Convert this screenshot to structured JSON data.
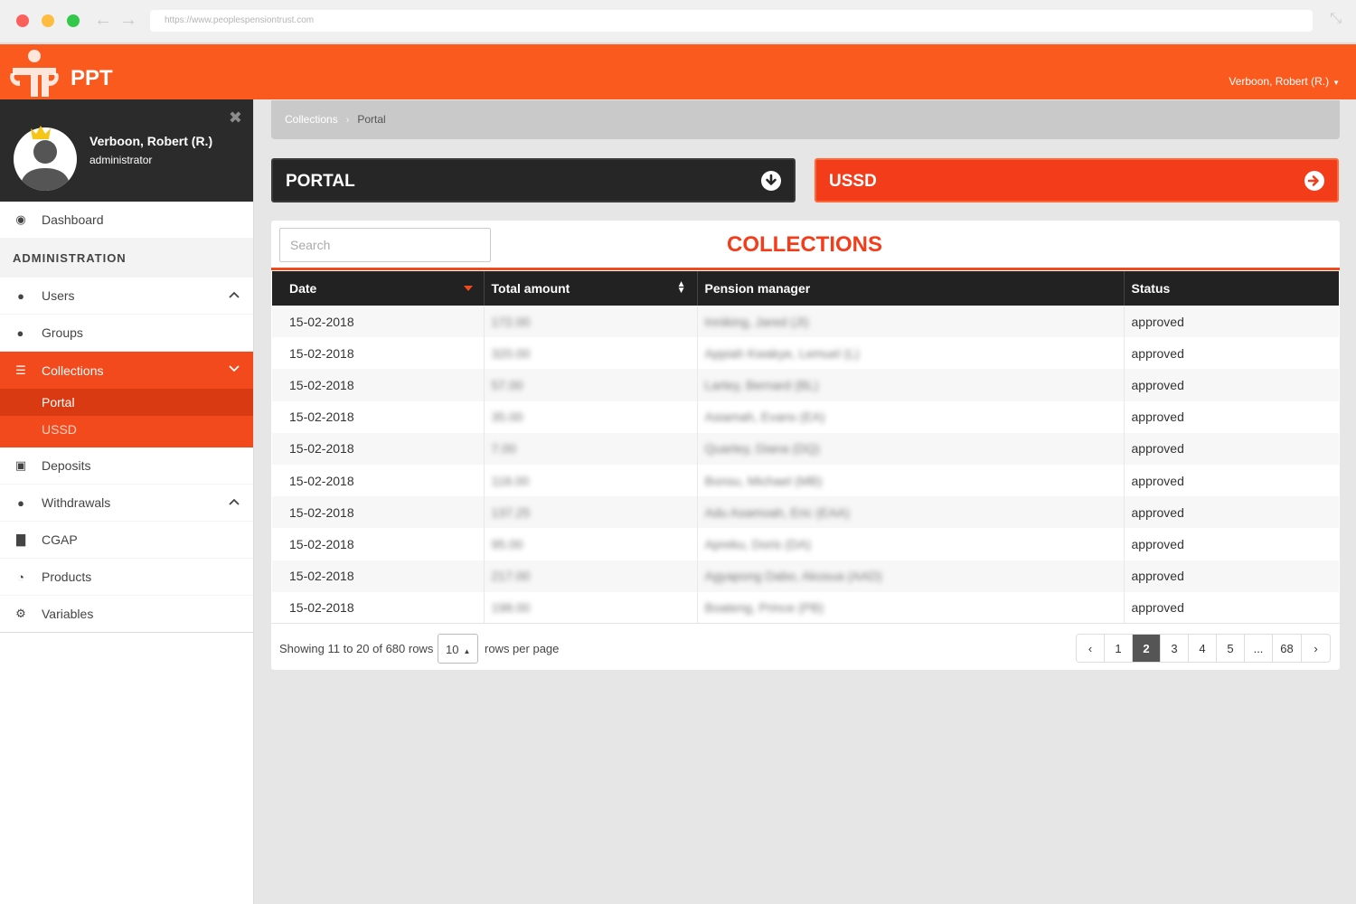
{
  "browser": {
    "url": "https://www.peoplespensiontrust.com"
  },
  "header": {
    "brand": "PPT",
    "user_menu": "Verboon, Robert (R.)"
  },
  "profile": {
    "name": "Verboon, Robert (R.)",
    "role": "administrator"
  },
  "sidebar": {
    "dashboard": "Dashboard",
    "section": "ADMINISTRATION",
    "users": "Users",
    "groups": "Groups",
    "collections": "Collections",
    "sub_portal": "Portal",
    "sub_ussd": "USSD",
    "deposits": "Deposits",
    "withdrawals": "Withdrawals",
    "cgap": "CGAP",
    "products": "Products",
    "variables": "Variables"
  },
  "breadcrumb": {
    "root": "Collections",
    "current": "Portal"
  },
  "panels": {
    "portal": "PORTAL",
    "ussd": "USSD"
  },
  "collections": {
    "title": "COLLECTIONS",
    "search_placeholder": "Search",
    "columns": [
      "Date",
      "Total amount",
      "Pension manager",
      "Status"
    ],
    "rows": [
      [
        "15-02-2018",
        "172.00",
        "Inniking, Jared (JI)",
        "approved"
      ],
      [
        "15-02-2018",
        "320.00",
        "Appiah Kwakye, Lemuel (L)",
        "approved"
      ],
      [
        "15-02-2018",
        "57.00",
        "Lartey, Bernard (BL)",
        "approved"
      ],
      [
        "15-02-2018",
        "35.00",
        "Asiamah, Evans (EA)",
        "approved"
      ],
      [
        "15-02-2018",
        "7.00",
        "Quartey, Diana (DQ)",
        "approved"
      ],
      [
        "15-02-2018",
        "118.00",
        "Bonsu, Michael (MB)",
        "approved"
      ],
      [
        "15-02-2018",
        "137.25",
        "Adu Asamoah, Eric (EAA)",
        "approved"
      ],
      [
        "15-02-2018",
        "95.00",
        "Apreku, Doris (DA)",
        "approved"
      ],
      [
        "15-02-2018",
        "217.00",
        "Agyapong Dabo, Akosua (AAD)",
        "approved"
      ],
      [
        "15-02-2018",
        "198.00",
        "Boateng, Prince (PB)",
        "approved"
      ]
    ],
    "footer": {
      "showing": "Showing 11 to 20 of 680 rows",
      "per_page_value": "10",
      "rows_per_page": "rows per page"
    },
    "pagination": {
      "prev": "‹",
      "pages": [
        "1",
        "2",
        "3",
        "4",
        "5",
        "...",
        "68"
      ],
      "active_page": "2",
      "next": "›"
    }
  },
  "colors": {
    "brand_orange": "#fa5a1e",
    "accent_red": "#f23c1a",
    "dark": "#262626"
  }
}
